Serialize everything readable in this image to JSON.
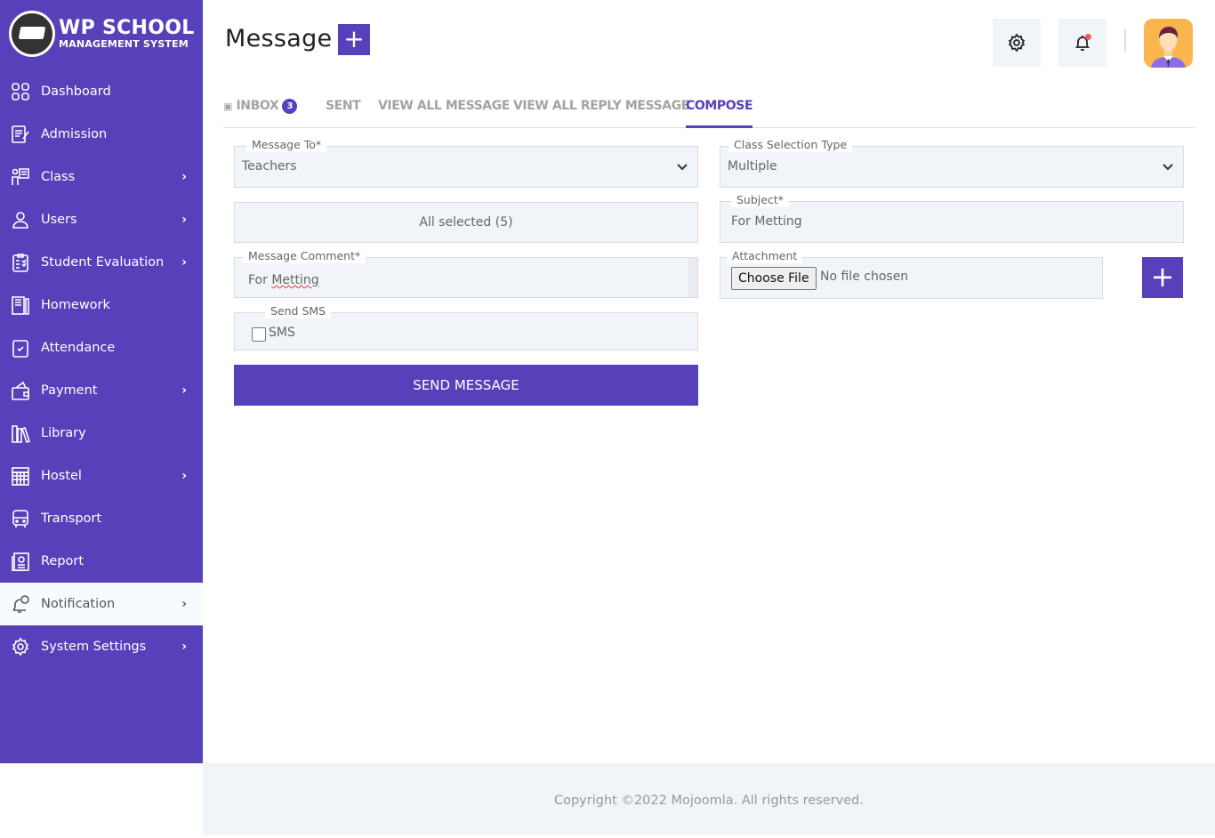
{
  "brand": {
    "line1": "WP SCHOOL",
    "line2": "MANAGEMENT SYSTEM",
    "accent": "#5840bb"
  },
  "sidebar": {
    "items": [
      {
        "label": "Dashboard",
        "icon": "dashboard-icon",
        "has_submenu": false
      },
      {
        "label": "Admission",
        "icon": "admission-icon",
        "has_submenu": false
      },
      {
        "label": "Class",
        "icon": "class-icon",
        "has_submenu": true
      },
      {
        "label": "Users",
        "icon": "user-icon",
        "has_submenu": true
      },
      {
        "label": "Student Evaluation",
        "icon": "evaluation-icon",
        "has_submenu": true
      },
      {
        "label": "Homework",
        "icon": "homework-icon",
        "has_submenu": false
      },
      {
        "label": "Attendance",
        "icon": "attendance-icon",
        "has_submenu": false
      },
      {
        "label": "Payment",
        "icon": "wallet-icon",
        "has_submenu": true
      },
      {
        "label": "Library",
        "icon": "library-icon",
        "has_submenu": false
      },
      {
        "label": "Hostel",
        "icon": "hostel-icon",
        "has_submenu": true
      },
      {
        "label": "Transport",
        "icon": "bus-icon",
        "has_submenu": false
      },
      {
        "label": "Report",
        "icon": "report-icon",
        "has_submenu": false
      },
      {
        "label": "Notification",
        "icon": "notification-icon",
        "has_submenu": true,
        "active": true
      },
      {
        "label": "System Settings",
        "icon": "gear-icon",
        "has_submenu": true
      }
    ],
    "chevron": "›"
  },
  "header": {
    "title": "Message",
    "add_symbol": "+"
  },
  "tabs": [
    {
      "label": "INBOX",
      "badge": "3"
    },
    {
      "label": "SENT"
    },
    {
      "label": "VIEW ALL MESSAGE"
    },
    {
      "label": "VIEW ALL REPLY MESSAGE"
    },
    {
      "label": "COMPOSE",
      "active": true
    }
  ],
  "form": {
    "message_to": {
      "label": "Message To*",
      "value": "Teachers"
    },
    "recipients": {
      "value": "All selected (5)"
    },
    "comment": {
      "label": "Message Comment*",
      "value_prefix": "For ",
      "value_misspelled": "Metting"
    },
    "send_sms": {
      "label": "Send SMS",
      "option": "SMS",
      "checked": false
    },
    "send_button": "SEND MESSAGE",
    "class_type": {
      "label": "Class Selection Type",
      "value": "Multiple"
    },
    "subject": {
      "label": "Subject*",
      "value": "For Metting"
    },
    "attachment": {
      "label": "Attachment",
      "button": "Choose File",
      "status": "No file chosen"
    },
    "add_attachment": "+"
  },
  "footer": {
    "text": "Copyright ©2022 Mojoomla. All rights reserved."
  }
}
